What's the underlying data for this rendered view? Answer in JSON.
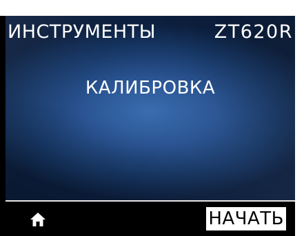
{
  "header": {
    "title": "ИНСТРУМЕНТЫ",
    "model": "ZT620R"
  },
  "main": {
    "item_label": "КАЛИБРОВКА"
  },
  "footer": {
    "home_icon": "home-icon",
    "start_label": "НАЧАТЬ"
  },
  "colors": {
    "background_dark": "#000000",
    "panel_blue": "#2a5492",
    "text": "#ffffff",
    "button_bg": "#ffffff",
    "button_text": "#000000"
  }
}
